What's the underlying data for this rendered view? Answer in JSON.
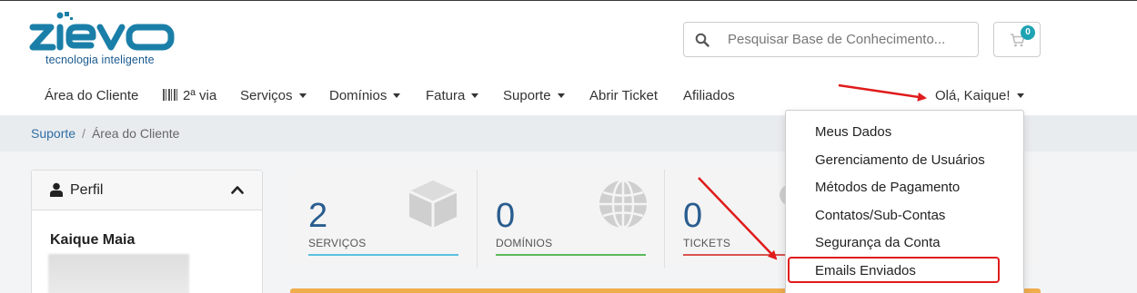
{
  "brand": {
    "logo_text": "zievo",
    "tagline": "tecnologia inteligente",
    "logo_color": "#1a7fa8"
  },
  "search": {
    "placeholder": "Pesquisar Base de Conhecimento..."
  },
  "cart": {
    "count": "0"
  },
  "nav": {
    "items": [
      {
        "label": "Área do Cliente",
        "dropdown": false
      },
      {
        "label": "2ª via",
        "dropdown": false,
        "icon": "barcode-icon"
      },
      {
        "label": "Serviços",
        "dropdown": true
      },
      {
        "label": "Domínios",
        "dropdown": true
      },
      {
        "label": "Fatura",
        "dropdown": true
      },
      {
        "label": "Suporte",
        "dropdown": true
      },
      {
        "label": "Abrir Ticket",
        "dropdown": false
      },
      {
        "label": "Afiliados",
        "dropdown": false
      }
    ],
    "user_menu": "Olá, Kaique!"
  },
  "breadcrumb": {
    "items": [
      "Suporte",
      "Área do Cliente"
    ]
  },
  "profile": {
    "title": "Perfil",
    "name": "Kaique Maia"
  },
  "stats": [
    {
      "value": "2",
      "label": "SERVIÇOS",
      "color": "#5bc0de",
      "icon": "cube-icon"
    },
    {
      "value": "0",
      "label": "DOMÍNIOS",
      "color": "#5cb85c",
      "icon": "globe-icon"
    },
    {
      "value": "0",
      "label": "TICKETS",
      "color": "#d9534f",
      "icon": "comments-icon"
    }
  ],
  "user_dropdown": {
    "items": [
      "Meus Dados",
      "Gerenciamento de Usuários",
      "Métodos de Pagamento",
      "Contatos/Sub-Contas",
      "Segurança da Conta",
      "Emails Enviados"
    ],
    "highlighted": "Emails Enviados",
    "annotation_color": "#e01b1b"
  }
}
